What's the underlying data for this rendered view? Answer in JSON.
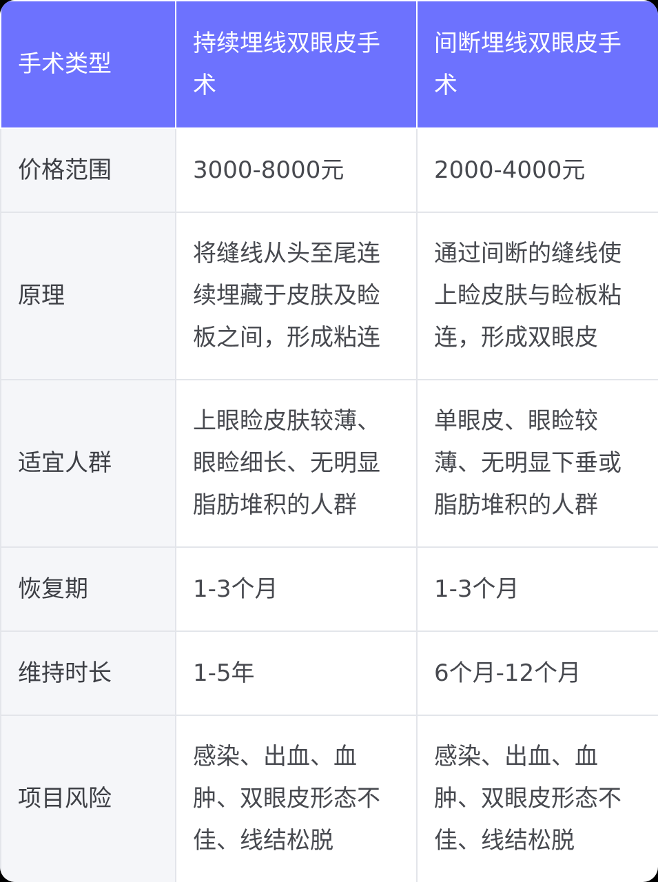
{
  "header": {
    "col1": "手术类型",
    "col2": "持续埋线双眼皮手术",
    "col3": "间断埋线双眼皮手术"
  },
  "rows": [
    {
      "label": "价格范围",
      "continuous": "3000-8000元",
      "interrupted": "2000-4000元"
    },
    {
      "label": "原理",
      "continuous": "将缝线从头至尾连续埋藏于皮肤及睑板之间，形成粘连",
      "interrupted": "通过间断的缝线使上睑皮肤与睑板粘连，形成双眼皮"
    },
    {
      "label": "适宜人群",
      "continuous": "上眼睑皮肤较薄、眼睑细长、无明显脂肪堆积的人群",
      "interrupted": "单眼皮、眼睑较薄、无明显下垂或脂肪堆积的人群"
    },
    {
      "label": "恢复期",
      "continuous": "1-3个月",
      "interrupted": "1-3个月"
    },
    {
      "label": "维持时长",
      "continuous": "1-5年",
      "interrupted": "6个月-12个月"
    },
    {
      "label": "项目风险",
      "continuous": "感染、出血、血肿、双眼皮形态不佳、线结松脱",
      "interrupted": "感染、出血、血肿、双眼皮形态不佳、线结松脱"
    }
  ],
  "colors": {
    "header_bg": "#6d72fe",
    "label_bg": "#f5f6f9",
    "border": "#e3e5ea"
  }
}
